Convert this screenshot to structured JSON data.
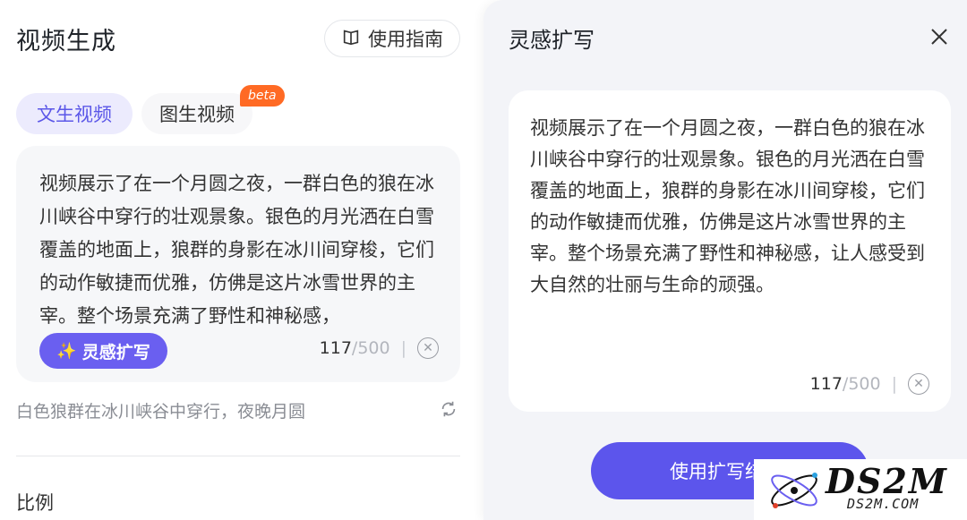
{
  "left": {
    "title": "视频生成",
    "guide_button": "使用指南",
    "tabs": [
      {
        "label": "文生视频",
        "active": true
      },
      {
        "label": "图生视频",
        "active": false
      }
    ],
    "beta_badge": "beta",
    "prompt_text": "视频展示了在一个月圆之夜，一群白色的狼在冰川峡谷中穿行的壮观景象。银色的月光洒在白雪覆盖的地面上，狼群的身影在冰川间穿梭，它们的动作敏捷而优雅，仿佛是这片冰雪世界的主宰。整个场景充满了野性和神秘感，",
    "inspire_button": "灵感扩写",
    "char_count": "117",
    "char_max": "/500",
    "suggestion": "白色狼群在冰川峡谷中穿行，夜晚月圆",
    "ratio_label": "比例"
  },
  "drawer": {
    "title": "灵感扩写",
    "expanded_text": "视频展示了在一个月圆之夜，一群白色的狼在冰川峡谷中穿行的壮观景象。银色的月光洒在白雪覆盖的地面上，狼群的身影在冰川间穿梭，它们的动作敏捷而优雅，仿佛是这片冰雪世界的主宰。整个场景充满了野性和神秘感，让人感受到大自然的壮丽与生命的顽强。",
    "char_count": "117",
    "char_max": "/500",
    "use_button": "使用扩写结果"
  },
  "watermark": {
    "main": "DS2M",
    "sub": "DS2M.COM"
  },
  "colors": {
    "accent": "#5c55ec",
    "tab_active_bg": "#ecebfd",
    "beta": "#ff6a24",
    "drawer_bg": "#f3f4f8"
  },
  "icons": [
    "book-icon",
    "magic-wand-icon",
    "clear-icon",
    "refresh-icon",
    "close-icon"
  ]
}
